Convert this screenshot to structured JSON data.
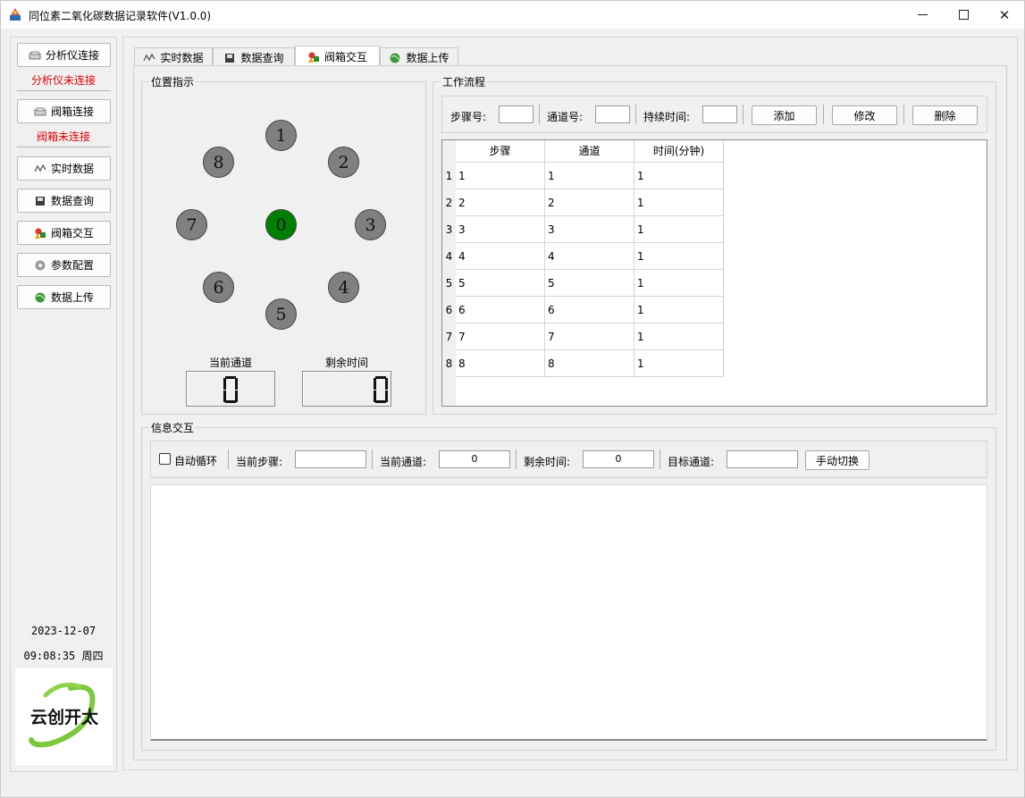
{
  "window": {
    "title": "同位素二氧化碳数据记录软件(V1.0.0)",
    "controls": [
      "minimize",
      "maximize",
      "close"
    ]
  },
  "sidebar": {
    "analyzer_button": "分析仪连接",
    "analyzer_status": "分析仪未连接",
    "valve_button": "阀箱连接",
    "valve_status": "阀箱未连接",
    "nav": [
      {
        "label": "实时数据",
        "icon": "realtime-chart-icon"
      },
      {
        "label": "数据查询",
        "icon": "database-icon"
      },
      {
        "label": "阀箱交互",
        "icon": "shapes-icon"
      },
      {
        "label": "参数配置",
        "icon": "gear-icon"
      },
      {
        "label": "数据上传",
        "icon": "globe-icon"
      }
    ],
    "date": "2023-12-07",
    "time": "09:08:35 周四",
    "logo_text": "云创开太",
    "status_color": "#e00000"
  },
  "tabs": [
    {
      "label": "实时数据",
      "icon": "realtime-chart-icon",
      "active": false
    },
    {
      "label": "数据查询",
      "icon": "database-icon",
      "active": false
    },
    {
      "label": "阀箱交互",
      "icon": "shapes-icon",
      "active": true
    },
    {
      "label": "数据上传",
      "icon": "globe-icon",
      "active": false
    }
  ],
  "position": {
    "title": "位置指示",
    "positions": [
      "0",
      "1",
      "2",
      "3",
      "4",
      "5",
      "6",
      "7",
      "8"
    ],
    "active_position": "0",
    "active_color": "#008000",
    "inactive_color": "#808080",
    "current_channel_label": "当前通道",
    "current_channel_value": "0",
    "remaining_time_label": "剩余时间",
    "remaining_time_value": "0"
  },
  "workflow": {
    "title": "工作流程",
    "step_label": "步骤号:",
    "step_value": "",
    "channel_label": "通道号:",
    "channel_value": "",
    "duration_label": "持续时间:",
    "duration_value": "",
    "add_button": "添加",
    "edit_button": "修改",
    "delete_button": "删除",
    "columns": [
      "步骤",
      "通道",
      "时间(分钟)"
    ],
    "rows": [
      {
        "row": "1",
        "step": "1",
        "channel": "1",
        "time": "1"
      },
      {
        "row": "2",
        "step": "2",
        "channel": "2",
        "time": "1"
      },
      {
        "row": "3",
        "step": "3",
        "channel": "3",
        "time": "1"
      },
      {
        "row": "4",
        "step": "4",
        "channel": "4",
        "time": "1"
      },
      {
        "row": "5",
        "step": "5",
        "channel": "5",
        "time": "1"
      },
      {
        "row": "6",
        "step": "6",
        "channel": "6",
        "time": "1"
      },
      {
        "row": "7",
        "step": "7",
        "channel": "7",
        "time": "1"
      },
      {
        "row": "8",
        "step": "8",
        "channel": "8",
        "time": "1"
      }
    ]
  },
  "info": {
    "title": "信息交互",
    "auto_loop_label": "自动循环",
    "auto_loop_checked": false,
    "current_step_label": "当前步骤:",
    "current_step_value": "",
    "current_channel_label": "当前通道:",
    "current_channel_value": "0",
    "remaining_label": "剩余时间:",
    "remaining_value": "0",
    "target_label": "目标通道:",
    "target_value": "",
    "manual_switch_button": "手动切换",
    "log_text": ""
  }
}
